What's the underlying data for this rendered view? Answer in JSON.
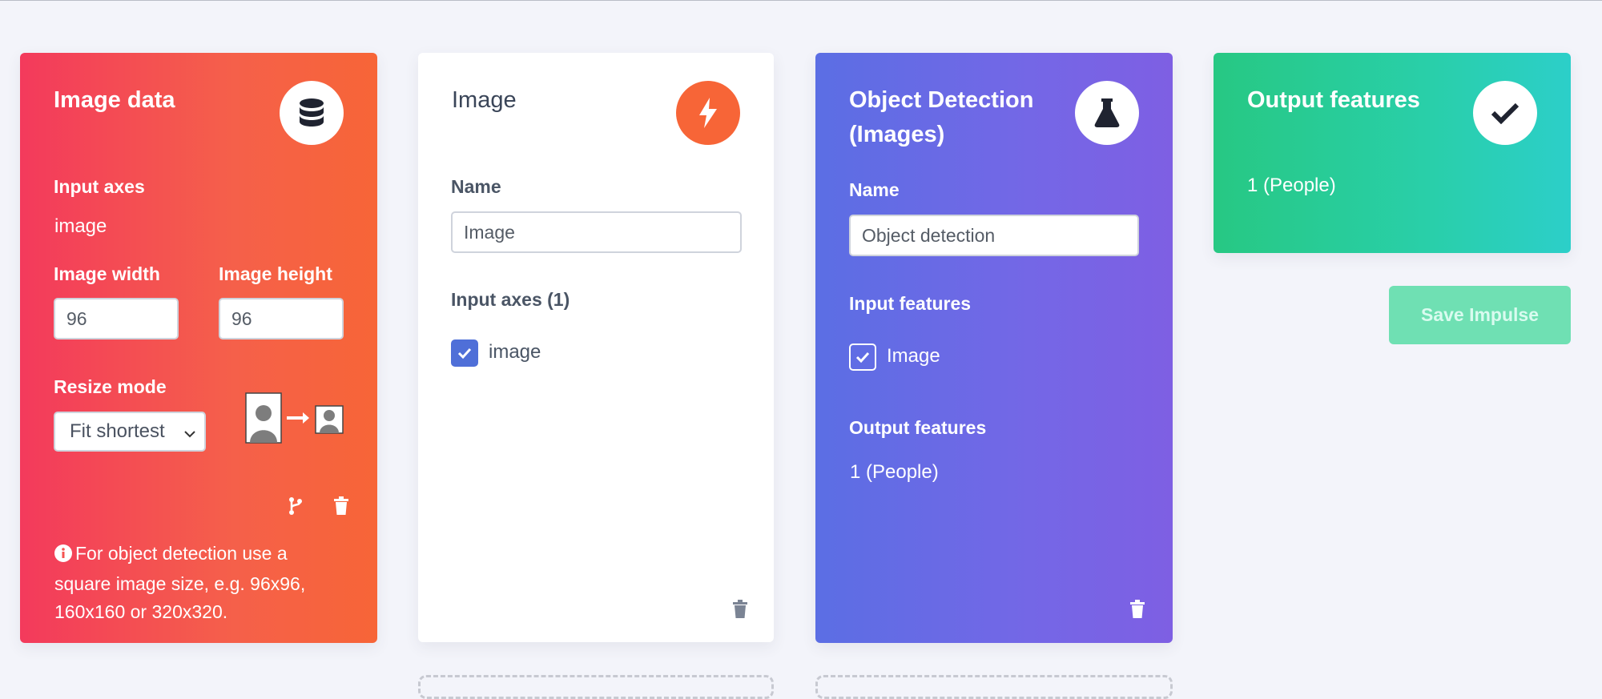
{
  "blocks": {
    "input": {
      "title": "Image data",
      "icon": "database-icon",
      "input_axes_label": "Input axes",
      "input_axes_value": "image",
      "width_label": "Image width",
      "width_value": "96",
      "height_label": "Image height",
      "height_value": "96",
      "resize_label": "Resize mode",
      "resize_value": "Fit shortest",
      "info_text": "For object detection use a square image size, e.g. 96x96, 160x160 or 320x320.",
      "bg_colors": [
        "#f33a5c",
        "#f76537"
      ]
    },
    "processing": {
      "title": "Image",
      "icon": "bolt-icon",
      "name_label": "Name",
      "name_value": "Image",
      "input_axes_label": "Input axes (1)",
      "axis_item": "image",
      "accent": "#f76537"
    },
    "learning": {
      "title_line1": "Object Detection",
      "title_line2": "(Images)",
      "icon": "flask-icon",
      "name_label": "Name",
      "name_value": "Object detection",
      "input_features_label": "Input features",
      "input_feature_item": "Image",
      "output_features_label": "Output features",
      "output_features_value": "1 (People)",
      "bg_colors": [
        "#5b6ee4",
        "#7e5fe3"
      ]
    },
    "output": {
      "title": "Output features",
      "icon": "check-icon",
      "value": "1 (People)",
      "bg_colors": [
        "#27c883",
        "#2ccfc9"
      ]
    }
  },
  "actions": {
    "save_label": "Save Impulse"
  }
}
